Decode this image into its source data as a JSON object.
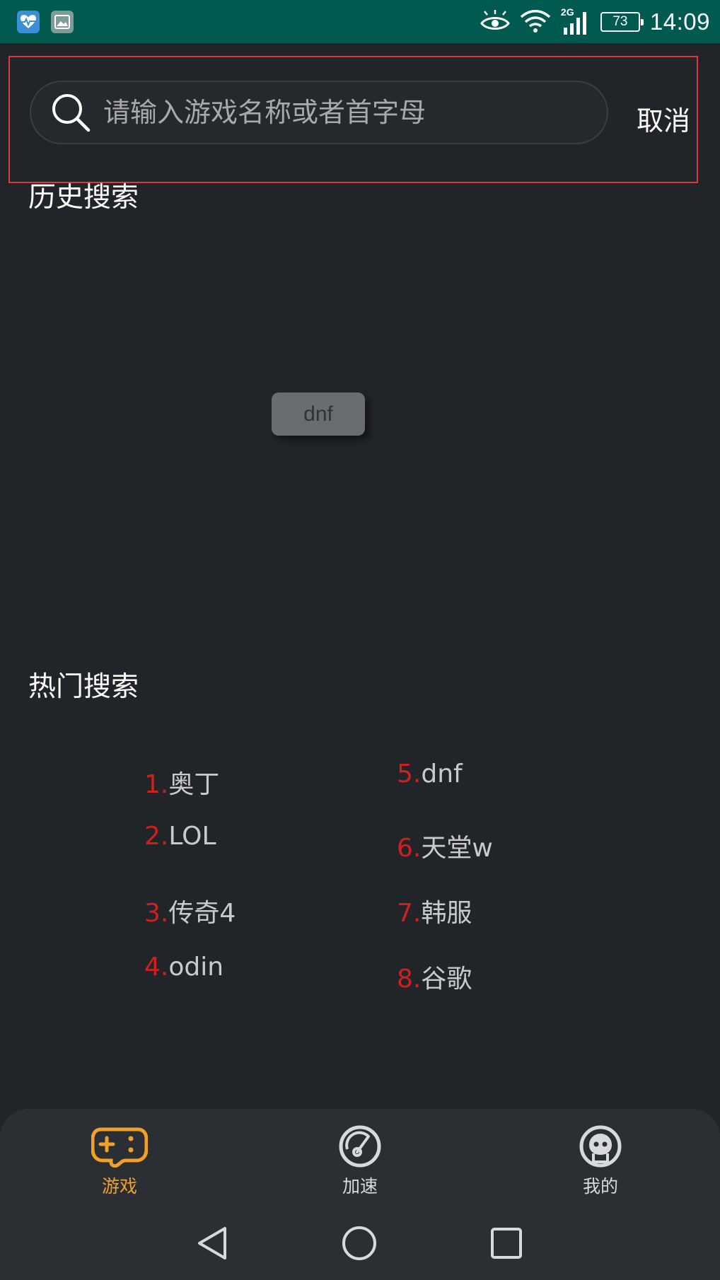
{
  "status_bar": {
    "time": "14:09",
    "battery": "73",
    "network": "2G",
    "icons": [
      "health-app-icon",
      "gallery-app-icon",
      "eye-icon",
      "wifi-icon",
      "signal-icon",
      "battery-icon"
    ]
  },
  "search": {
    "placeholder": "请输入游戏名称或者首字母",
    "value": "",
    "cancel_label": "取消",
    "highlight_color": "#d93a3a"
  },
  "history": {
    "title": "历史搜索",
    "items": [
      "dnf"
    ]
  },
  "hot": {
    "title": "热门搜索",
    "items": [
      {
        "num": "1.",
        "name": "奥丁"
      },
      {
        "num": "2.",
        "name": "LOL"
      },
      {
        "num": "3.",
        "name": "传奇4"
      },
      {
        "num": "4.",
        "name": "odin"
      },
      {
        "num": "5.",
        "name": "dnf"
      },
      {
        "num": "6.",
        "name": "天堂w"
      },
      {
        "num": "7.",
        "name": "韩服"
      },
      {
        "num": "8.",
        "name": "谷歌"
      }
    ],
    "number_color": "#d0201c"
  },
  "bottom_nav": {
    "active_color": "#f0a12a",
    "tabs": [
      {
        "label": "游戏",
        "icon": "gamepad-icon",
        "active": true
      },
      {
        "label": "加速",
        "icon": "speedometer-icon",
        "active": false
      },
      {
        "label": "我的",
        "icon": "profile-icon",
        "active": false
      }
    ]
  },
  "system_nav": [
    "back-icon",
    "home-icon",
    "recents-icon"
  ]
}
